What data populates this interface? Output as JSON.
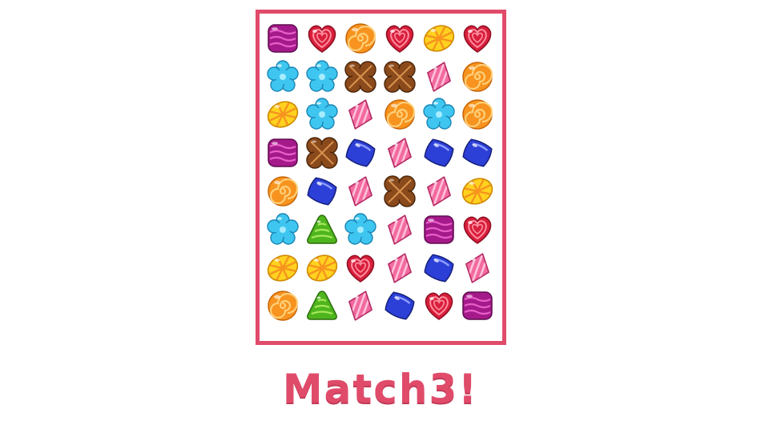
{
  "title": "Match3!",
  "colors": {
    "accent": "#e04b6a",
    "background": "#ffffff"
  },
  "board": {
    "columns": 6,
    "rows": 8,
    "grid": [
      [
        "purple-square-candy",
        "red-heart-candy",
        "orange-swirl-candy",
        "red-heart-candy",
        "yellow-striped-candy",
        "red-heart-candy"
      ],
      [
        "blue-flower-candy",
        "blue-flower-candy",
        "brown-clover-candy",
        "brown-clover-candy",
        "pink-diamond-candy",
        "orange-swirl-candy"
      ],
      [
        "yellow-striped-candy",
        "blue-flower-candy",
        "pink-diamond-candy",
        "orange-swirl-candy",
        "blue-flower-candy",
        "orange-swirl-candy"
      ],
      [
        "purple-square-candy",
        "brown-clover-candy",
        "blue-jelly-candy",
        "pink-diamond-candy",
        "blue-jelly-candy",
        "blue-jelly-candy"
      ],
      [
        "orange-swirl-candy",
        "blue-jelly-candy",
        "pink-diamond-candy",
        "brown-clover-candy",
        "pink-diamond-candy",
        "yellow-striped-candy"
      ],
      [
        "blue-flower-candy",
        "green-triangle-candy",
        "blue-flower-candy",
        "pink-diamond-candy",
        "purple-square-candy",
        "red-heart-candy"
      ],
      [
        "yellow-striped-candy",
        "yellow-striped-candy",
        "red-heart-candy",
        "pink-diamond-candy",
        "blue-jelly-candy",
        "pink-diamond-candy"
      ],
      [
        "orange-swirl-candy",
        "green-triangle-candy",
        "pink-diamond-candy",
        "blue-jelly-candy",
        "red-heart-candy",
        "purple-square-candy"
      ]
    ]
  }
}
